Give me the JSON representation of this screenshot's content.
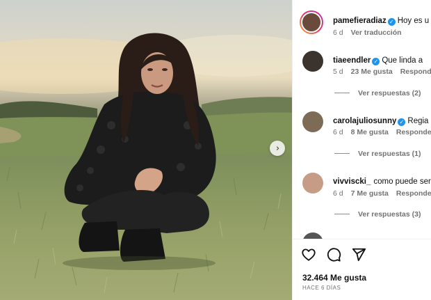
{
  "post": {
    "author": "pamefieradiaz",
    "caption_preview": "Hoy es u",
    "time": "6 d",
    "translate_label": "Ver traducción",
    "likes": "32.464 Me gusta",
    "posted_ago": "HACE 6 DÍAS"
  },
  "comments": [
    {
      "user": "tiaeendler",
      "verified": true,
      "text": "Que linda a",
      "time": "5 d",
      "likes": "23 Me gusta",
      "reply_label": "Responder",
      "replies": "Ver respuestas (2)"
    },
    {
      "user": "carolajuliosunny",
      "verified": true,
      "text": "Regia",
      "time": "6 d",
      "likes": "8 Me gusta",
      "reply_label": "Responder",
      "replies": "Ver respuestas (1)"
    },
    {
      "user": "vivviscki_",
      "verified": false,
      "text": "como puede ser t",
      "time": "6 d",
      "likes": "7 Me gusta",
      "reply_label": "Responder",
      "replies": "Ver respuestas (3)"
    }
  ],
  "icons": {
    "like": "heart-icon",
    "comment": "comment-icon",
    "share": "send-icon",
    "verified": "verified-badge-icon",
    "next": "chevron-right-icon"
  },
  "colors": {
    "verified": "#1d95f0",
    "meta_text": "#737373",
    "story_ring": "#e6375f"
  }
}
